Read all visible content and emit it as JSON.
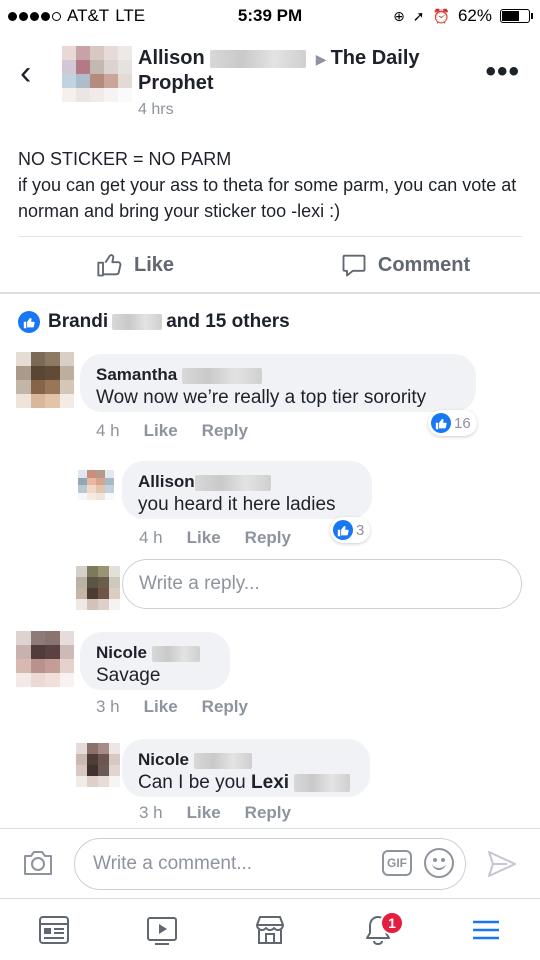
{
  "status_bar": {
    "carrier": "AT&T",
    "network": "LTE",
    "time": "5:39 PM",
    "battery": "62%"
  },
  "post": {
    "author": "Allison",
    "group": "The Daily Prophet",
    "time": "4 hrs",
    "text_line1": "NO STICKER = NO PARM",
    "text_line2": "if you can get your ass to theta for some parm, you can vote at norman and bring your sticker too -lexi :)",
    "like_label": "Like",
    "comment_label": "Comment"
  },
  "likes_summary": {
    "name": "Brandi",
    "others": "and 15 others"
  },
  "comments": [
    {
      "name": "Samantha",
      "text": "Wow now we’re really a top tier sorority",
      "time": "4 h",
      "like": "Like",
      "reply": "Reply",
      "reactions": "16"
    },
    {
      "name": "Allison",
      "text": "you heard it here ladies",
      "time": "4 h",
      "like": "Like",
      "reply": "Reply",
      "reactions": "3"
    },
    {
      "name": "Nicole",
      "text": "Savage",
      "time": "3 h",
      "like": "Like",
      "reply": "Reply"
    },
    {
      "name": "Nicole",
      "text_prefix": "Can I be you ",
      "mention": "Lexi",
      "time": "3 h",
      "like": "Like",
      "reply": "Reply"
    }
  ],
  "reply_box": {
    "placeholder": "Write a reply..."
  },
  "composer": {
    "placeholder": "Write a comment...",
    "gif_label": "GIF"
  },
  "tabbar": {
    "notifications_badge": "1"
  },
  "colors": {
    "accent": "#1877f2",
    "badge": "#e41e3f",
    "muted": "#8d949e"
  }
}
